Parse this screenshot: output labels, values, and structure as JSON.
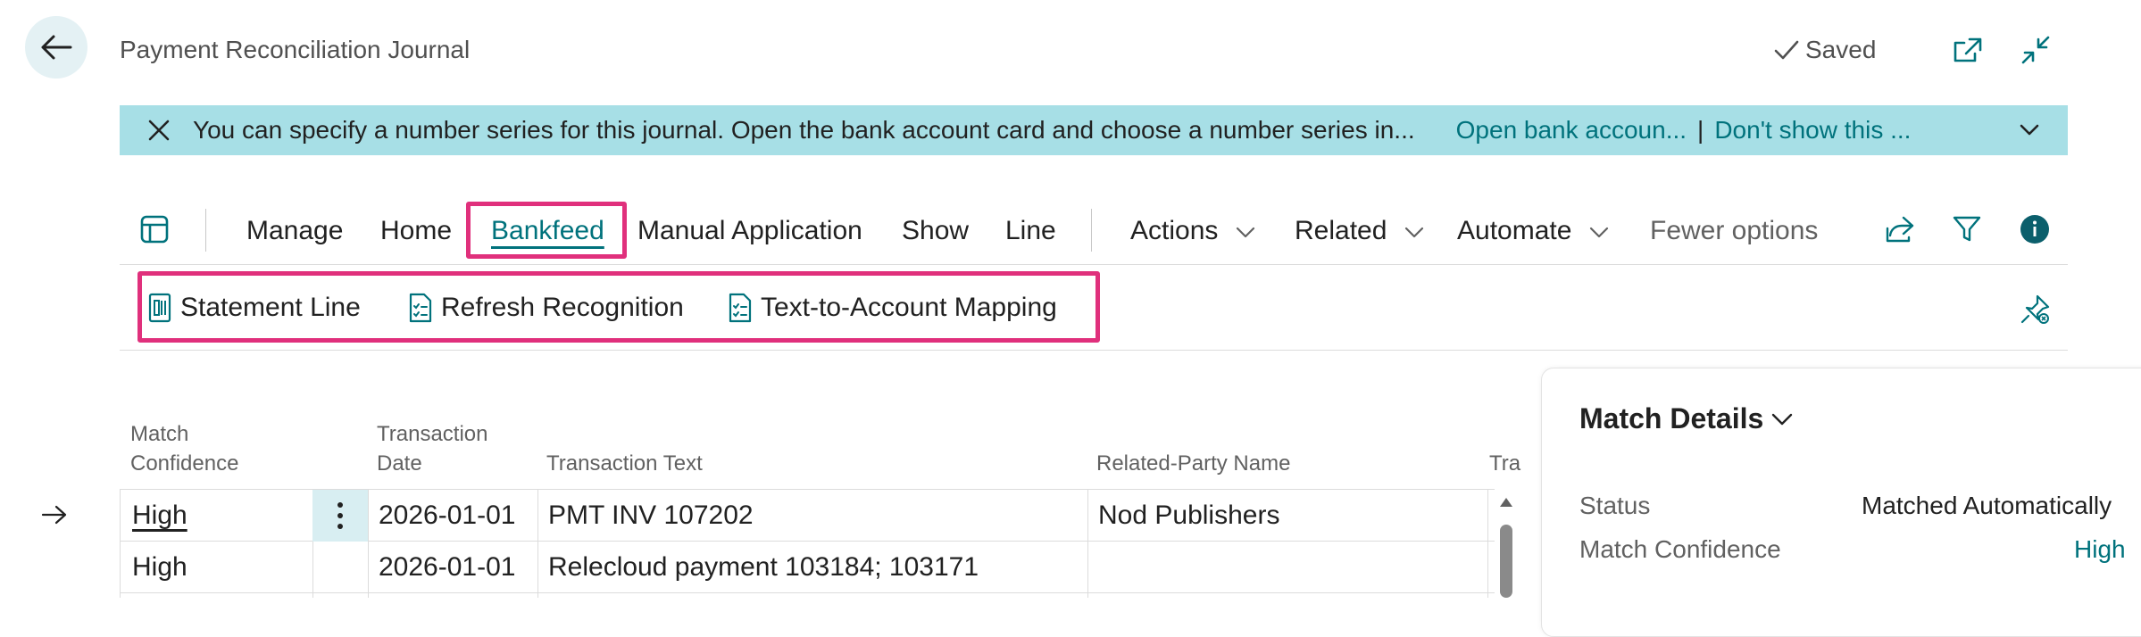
{
  "header": {
    "title": "Payment Reconciliation Journal",
    "saved_label": "Saved"
  },
  "notification": {
    "message": "You can specify a number series for this journal. Open the bank account card and choose a number series in...",
    "link_open": "Open bank accoun...",
    "separator": "|",
    "link_dismiss": "Don't show this ..."
  },
  "actionbar": {
    "tabs": [
      "Manage",
      "Home",
      "Bankfeed",
      "Manual Application",
      "Show",
      "Line"
    ],
    "actions": "Actions",
    "related": "Related",
    "automate": "Automate",
    "fewer_options": "Fewer options"
  },
  "subbar": {
    "items": [
      "Statement Line",
      "Refresh Recognition",
      "Text-to-Account Mapping"
    ]
  },
  "table": {
    "headers": {
      "match_confidence_1": "Match",
      "match_confidence_2": "Confidence",
      "transaction_date_1": "Transaction",
      "transaction_date_2": "Date",
      "transaction_text": "Transaction Text",
      "related_party": "Related-Party Name",
      "truncated": "Tra"
    },
    "rows": [
      {
        "confidence": "High",
        "date": "2026-01-01",
        "text": "PMT INV 107202",
        "party": "Nod Publishers"
      },
      {
        "confidence": "High",
        "date": "2026-01-01",
        "text": "Relecloud payment 103184; 103171",
        "party": ""
      }
    ]
  },
  "factbox": {
    "title": "Match Details",
    "fields": [
      {
        "label": "Status",
        "value": "Matched Automatically"
      },
      {
        "label": "Match Confidence",
        "value": "High"
      }
    ]
  },
  "colors": {
    "accent": "#00727c",
    "notification_bg": "#a7dfe6",
    "highlight": "#e0307c"
  }
}
